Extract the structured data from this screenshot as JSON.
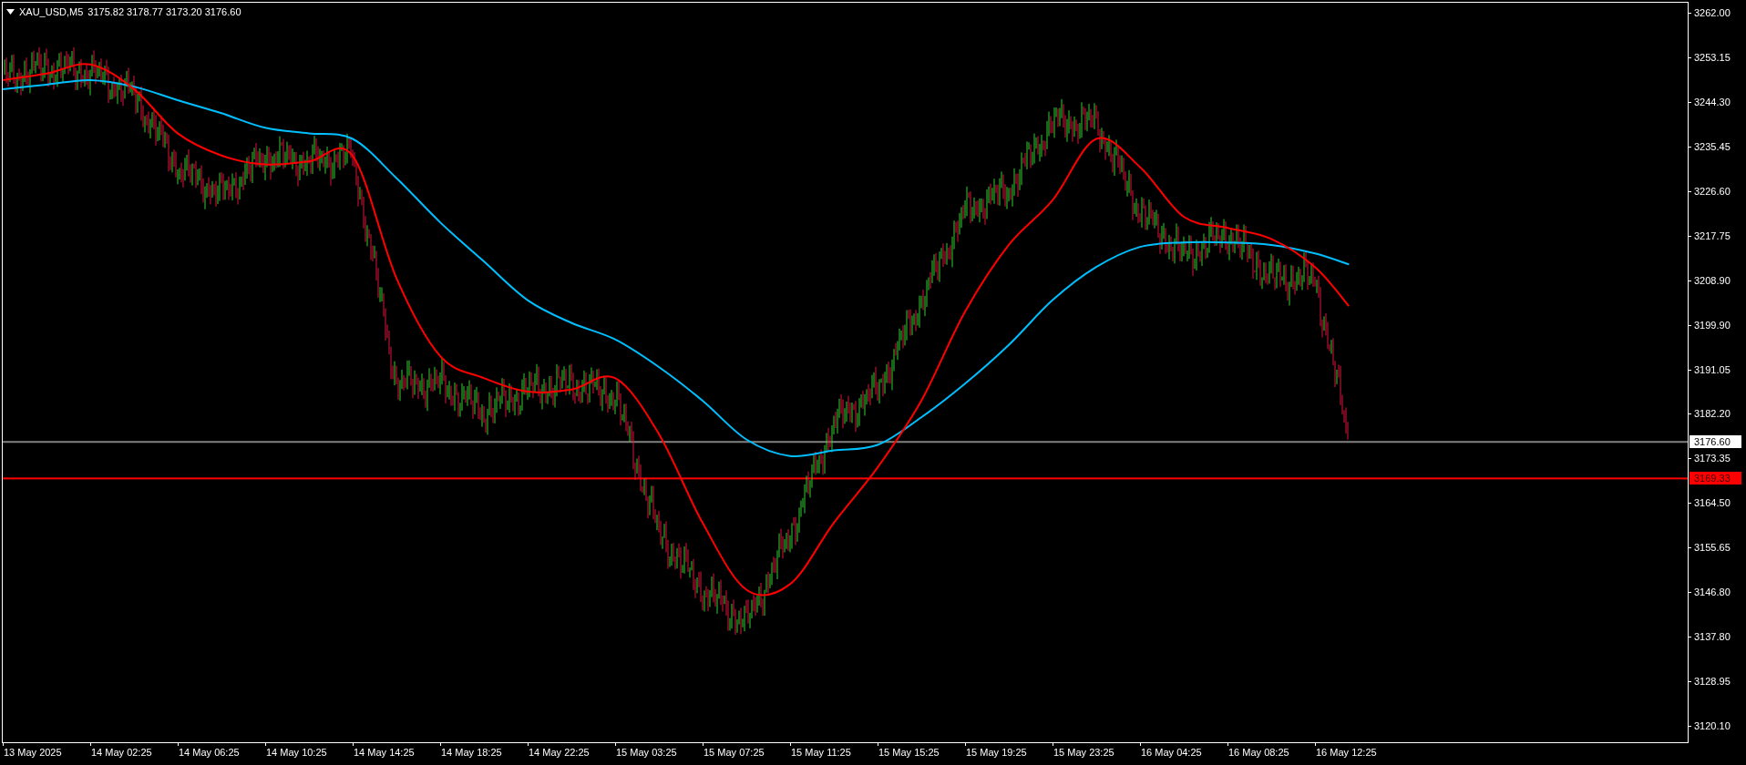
{
  "chart": {
    "header": {
      "symbol": "XAU_USD,M5",
      "ohlc": "3175.82 3178.77 3173.20 3176.60"
    },
    "price_lines": [
      {
        "label": "3176.60",
        "color": "#808080"
      },
      {
        "label": "3169.33",
        "color": "#ff0000"
      }
    ],
    "price_axis_labels": [
      "3262.00",
      "3253.15",
      "3244.30",
      "3235.45",
      "3226.60",
      "3217.75",
      "3208.90",
      "3199.90",
      "3191.05",
      "3182.20",
      "3173.35",
      "3164.50",
      "3155.65",
      "3146.80",
      "3137.80",
      "3128.95",
      "3120.10"
    ],
    "time_axis_labels": [
      "13 May 2025",
      "14 May 02:25",
      "14 May 06:25",
      "14 May 10:25",
      "14 May 14:25",
      "14 May 18:25",
      "14 May 22:25",
      "15 May 03:25",
      "15 May 07:25",
      "15 May 11:25",
      "15 May 15:25",
      "15 May 19:25",
      "15 May 23:25",
      "16 May 04:25",
      "16 May 08:25",
      "16 May 12:25"
    ]
  }
}
